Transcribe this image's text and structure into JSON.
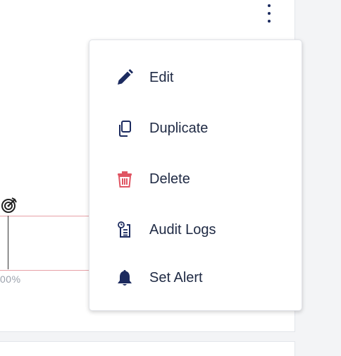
{
  "chart": {
    "axis_tick_label": "00%"
  },
  "menu": {
    "items": [
      {
        "label": "Edit",
        "icon": "pencil-icon"
      },
      {
        "label": "Duplicate",
        "icon": "copy-icon"
      },
      {
        "label": "Delete",
        "icon": "trash-icon"
      },
      {
        "label": "Audit Logs",
        "icon": "clipboard-clock-icon"
      },
      {
        "label": "Set Alert",
        "icon": "bell-icon"
      }
    ]
  },
  "colors": {
    "icon_navy": "#1c2b5f",
    "delete_red": "#e05563",
    "text": "#1f2a44",
    "range_border": "#e7a0a6"
  }
}
